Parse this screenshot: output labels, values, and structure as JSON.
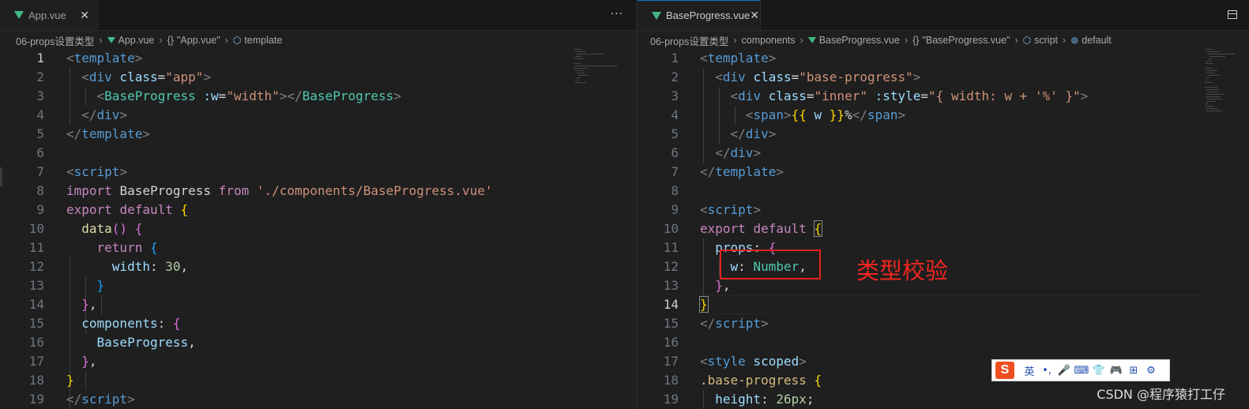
{
  "left": {
    "tab": {
      "title": "App.vue",
      "close": "✕",
      "more": "···"
    },
    "breadcrumb": [
      "06-props设置类型",
      "App.vue",
      "\"App.vue\"",
      "template"
    ],
    "lines": [
      "1",
      "2",
      "3",
      "4",
      "5",
      "6",
      "7",
      "8",
      "9",
      "10",
      "11",
      "12",
      "13",
      "14",
      "15",
      "16",
      "17",
      "18",
      "19"
    ],
    "code": {
      "import_path": "'./components/BaseProgress.vue'",
      "width_value": "30",
      "attr_value": "\"width\"",
      "class_value": "\"app\""
    }
  },
  "right": {
    "tab": {
      "title": "BaseProgress.vue",
      "close": "✕"
    },
    "breadcrumb": [
      "06-props设置类型",
      "components",
      "BaseProgress.vue",
      "\"BaseProgress.vue\"",
      "script",
      "default"
    ],
    "lines": [
      "1",
      "2",
      "3",
      "4",
      "5",
      "6",
      "7",
      "8",
      "9",
      "10",
      "11",
      "12",
      "13",
      "14",
      "15",
      "16",
      "17",
      "18",
      "19"
    ],
    "active_line": "14",
    "code": {
      "class_value": "\"base-progress\"",
      "inner_class": "\"inner\"",
      "style_value": "\"{ width: w + '%' }\"",
      "prop_type": "Number",
      "height_value": "26px"
    }
  },
  "annotation": "类型校验",
  "ime": {
    "logo": "S",
    "items": [
      "英",
      "•,",
      "🎤",
      "⌨",
      "👕",
      "🎮",
      "⊞",
      "⚙"
    ]
  },
  "watermark": "CSDN @程序猿打工仔"
}
